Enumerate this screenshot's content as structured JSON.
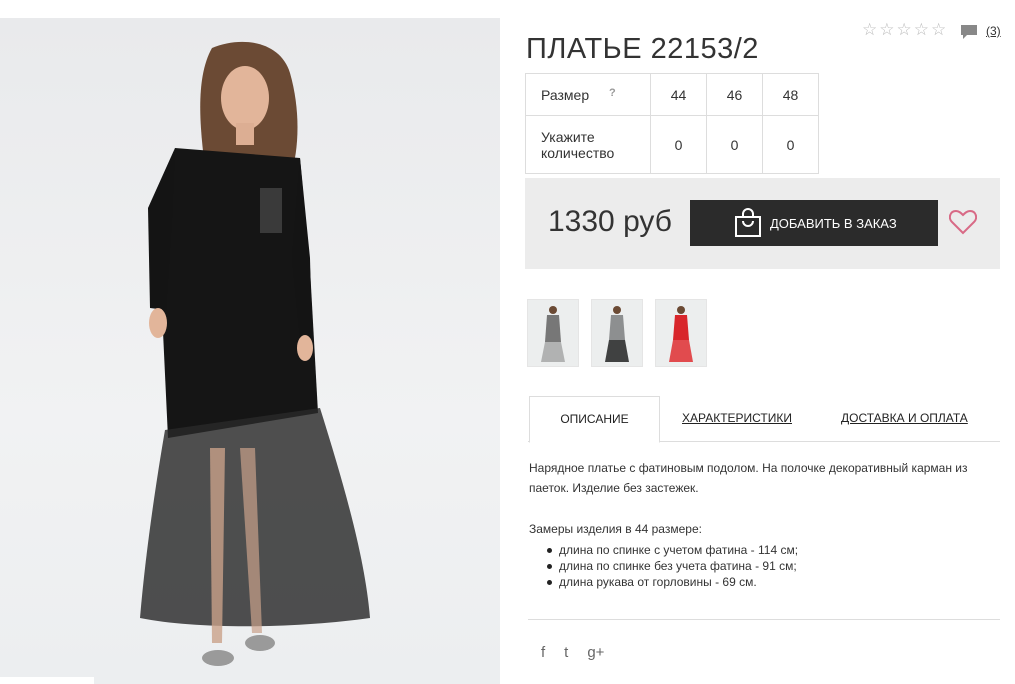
{
  "product": {
    "title": "ПЛАТЬЕ 22153/2",
    "rating_stars": 0,
    "rating_max": 5,
    "comments_count": "(3)"
  },
  "sizes": {
    "size_label": "Размер",
    "help": "?",
    "qty_label": "Укажите количество",
    "columns": [
      "44",
      "46",
      "48"
    ],
    "quantities": [
      "0",
      "0",
      "0"
    ]
  },
  "purchase": {
    "price": "1330 руб",
    "add_button": "ДОБАВИТЬ В ЗАКАЗ"
  },
  "tabs": [
    "ОПИСАНИЕ",
    "ХАРАКТЕРИСТИКИ",
    "ДОСТАВКА И ОПЛАТА"
  ],
  "description": {
    "text": "Нарядное платье с фатиновым подолом. На полочке декоративный карман из паеток. Изделие без застежек.",
    "measures_title": "Замеры изделия в 44 размере:",
    "measures": [
      "длина по спинке с учетом фатина - 114 см;",
      "длина по спинке без учета фатина - 91 см;",
      "длина рукава от горловины - 69 см."
    ]
  },
  "social": {
    "facebook": "f",
    "twitter": "t",
    "google": "g+"
  },
  "colors": {
    "button_bg": "#2b2b2b",
    "price_bg": "#ececec",
    "heart": "#d86a86",
    "thumb_red": "#d8262b"
  }
}
